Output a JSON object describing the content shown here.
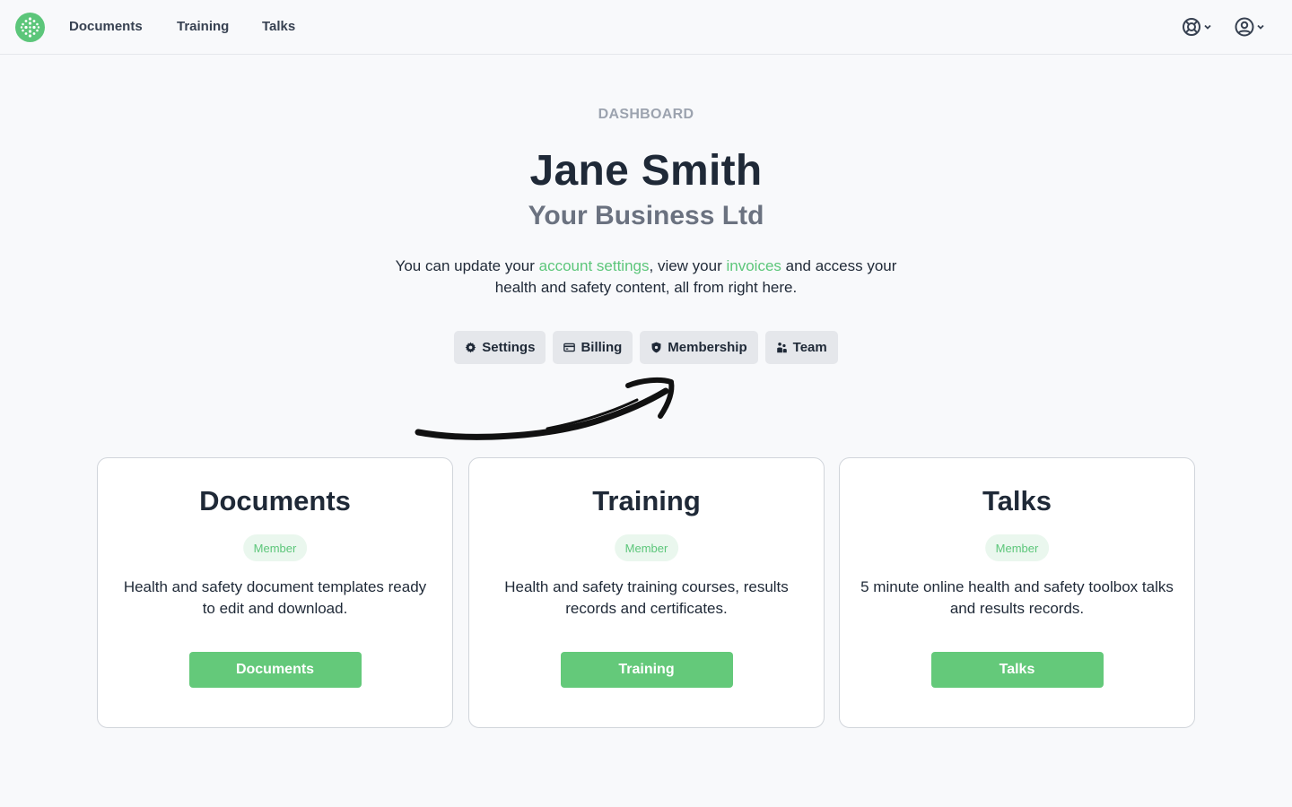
{
  "nav": {
    "links": [
      "Documents",
      "Training",
      "Talks"
    ]
  },
  "hero": {
    "eyebrow": "DASHBOARD",
    "name": "Jane Smith",
    "company": "Your Business Ltd",
    "text_1": "You can update your ",
    "link_account_settings": "account settings",
    "text_2": ", view your ",
    "link_invoices": "invoices",
    "text_3": " and access your health and safety content, all from right here."
  },
  "pills": [
    {
      "label": "Settings",
      "icon": "gear-icon"
    },
    {
      "label": "Billing",
      "icon": "credit-card-icon"
    },
    {
      "label": "Membership",
      "icon": "shield-icon"
    },
    {
      "label": "Team",
      "icon": "team-icon"
    }
  ],
  "cards": [
    {
      "title": "Documents",
      "badge": "Member",
      "description": "Health and safety document templates ready to edit and download.",
      "button": "Documents"
    },
    {
      "title": "Training",
      "badge": "Member",
      "description": "Health and safety training courses, results records and certificates.",
      "button": "Training"
    },
    {
      "title": "Talks",
      "badge": "Member",
      "description": "5 minute online health and safety toolbox talks and results records.",
      "button": "Talks"
    }
  ],
  "colors": {
    "accent": "#5cc67a",
    "text": "#1f2937",
    "muted": "#6b7280"
  }
}
